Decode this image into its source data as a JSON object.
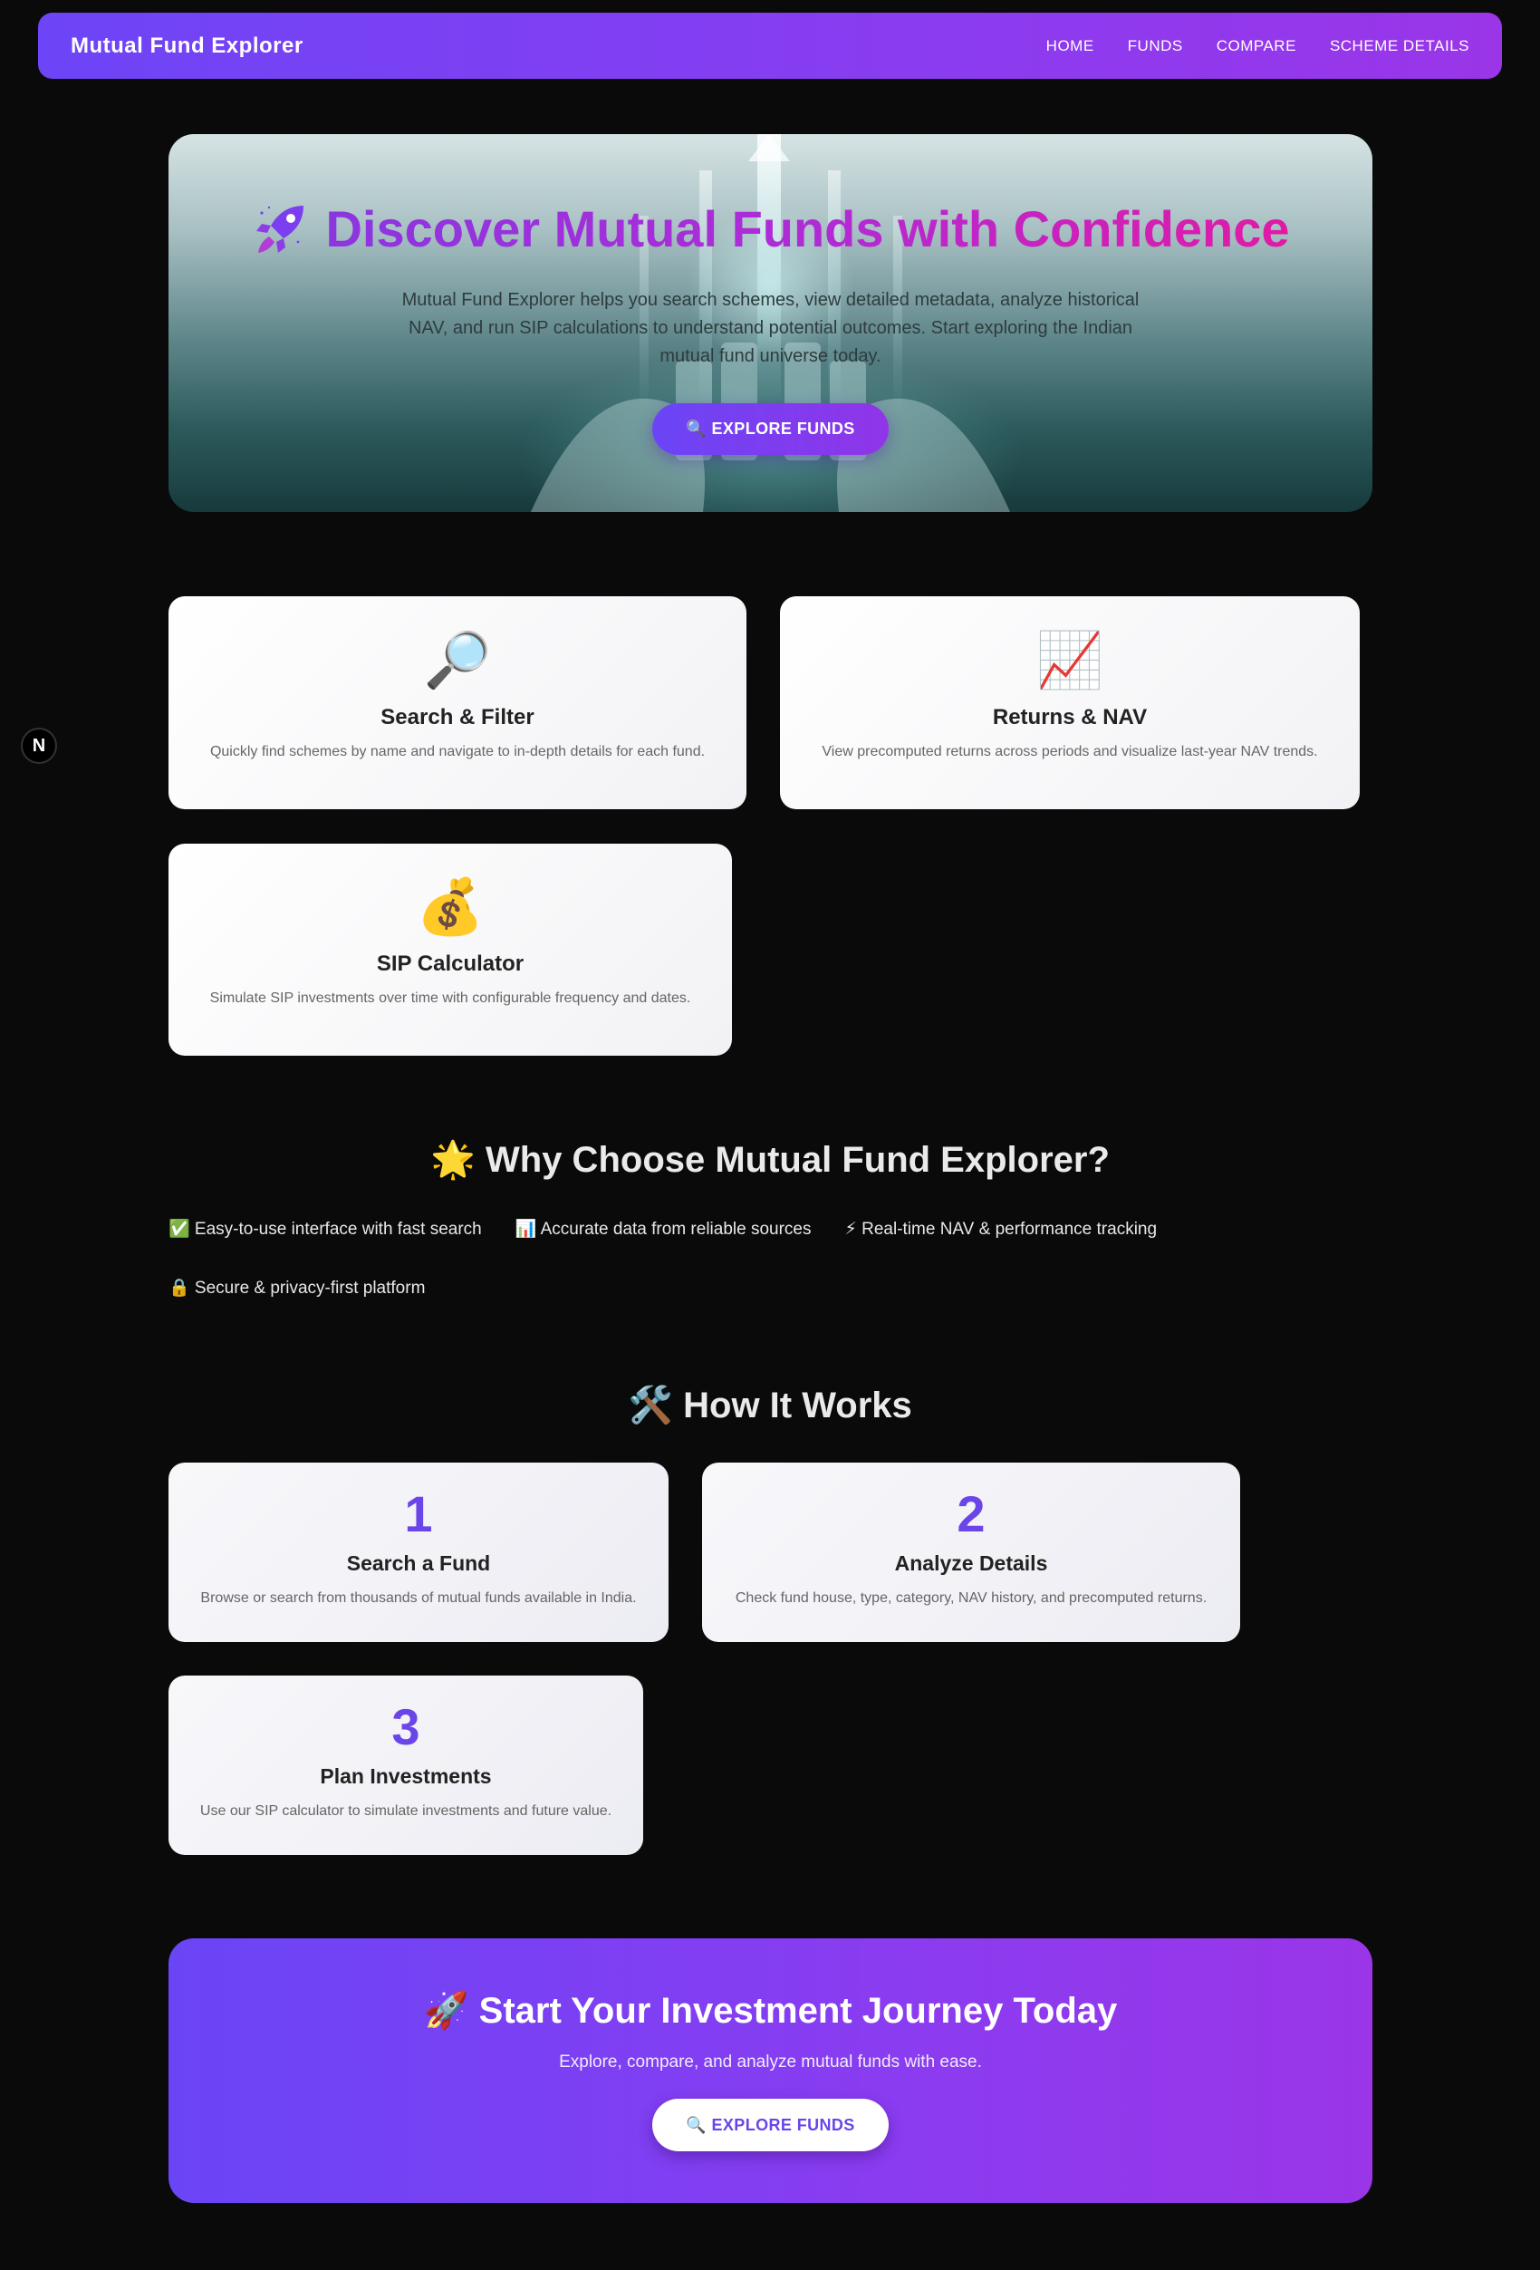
{
  "navbar": {
    "brand": "Mutual Fund Explorer",
    "links": [
      "HOME",
      "FUNDS",
      "COMPARE",
      "SCHEME DETAILS"
    ]
  },
  "dev_badge": {
    "letter": "N",
    "icon": "nextjs-icon"
  },
  "hero": {
    "icon": "rocket-icon",
    "title": "Discover Mutual Funds with Confidence",
    "description": "Mutual Fund Explorer helps you search schemes, view detailed metadata, analyze historical NAV, and run SIP calculations to understand potential outcomes. Start exploring the Indian mutual fund universe today.",
    "button_label": "🔍 EXPLORE FUNDS"
  },
  "features": [
    {
      "icon": "🔎",
      "title": "Search & Filter",
      "desc": "Quickly find schemes by name and navigate to in-depth details for each fund."
    },
    {
      "icon": "📈",
      "title": "Returns & NAV",
      "desc": "View precomputed returns across periods and visualize last-year NAV trends."
    },
    {
      "icon": "💰",
      "title": "SIP Calculator",
      "desc": "Simulate SIP investments over time with configurable frequency and dates."
    }
  ],
  "why": {
    "heading": "🌟 Why Choose Mutual Fund Explorer?",
    "points": [
      "✅ Easy-to-use interface with fast search",
      "📊 Accurate data from reliable sources",
      "⚡ Real-time NAV & performance tracking",
      "🔒 Secure & privacy-first platform"
    ]
  },
  "how": {
    "heading": "🛠️ How It Works",
    "steps": [
      {
        "num": "1",
        "title": "Search a Fund",
        "desc": "Browse or search from thousands of mutual funds available in India."
      },
      {
        "num": "2",
        "title": "Analyze Details",
        "desc": "Check fund house, type, category, NAV history, and precomputed returns."
      },
      {
        "num": "3",
        "title": "Plan Investments",
        "desc": "Use our SIP calculator to simulate investments and future value."
      }
    ]
  },
  "cta": {
    "title": "🚀 Start Your Investment Journey Today",
    "description": "Explore, compare, and analyze mutual funds with ease.",
    "button_label": "🔍 EXPLORE FUNDS"
  },
  "colors": {
    "background": "#0a0a0a",
    "accent": "#6a45f6",
    "accent_end": "#9a35e8",
    "title_gradient_end": "#e11aa6"
  }
}
